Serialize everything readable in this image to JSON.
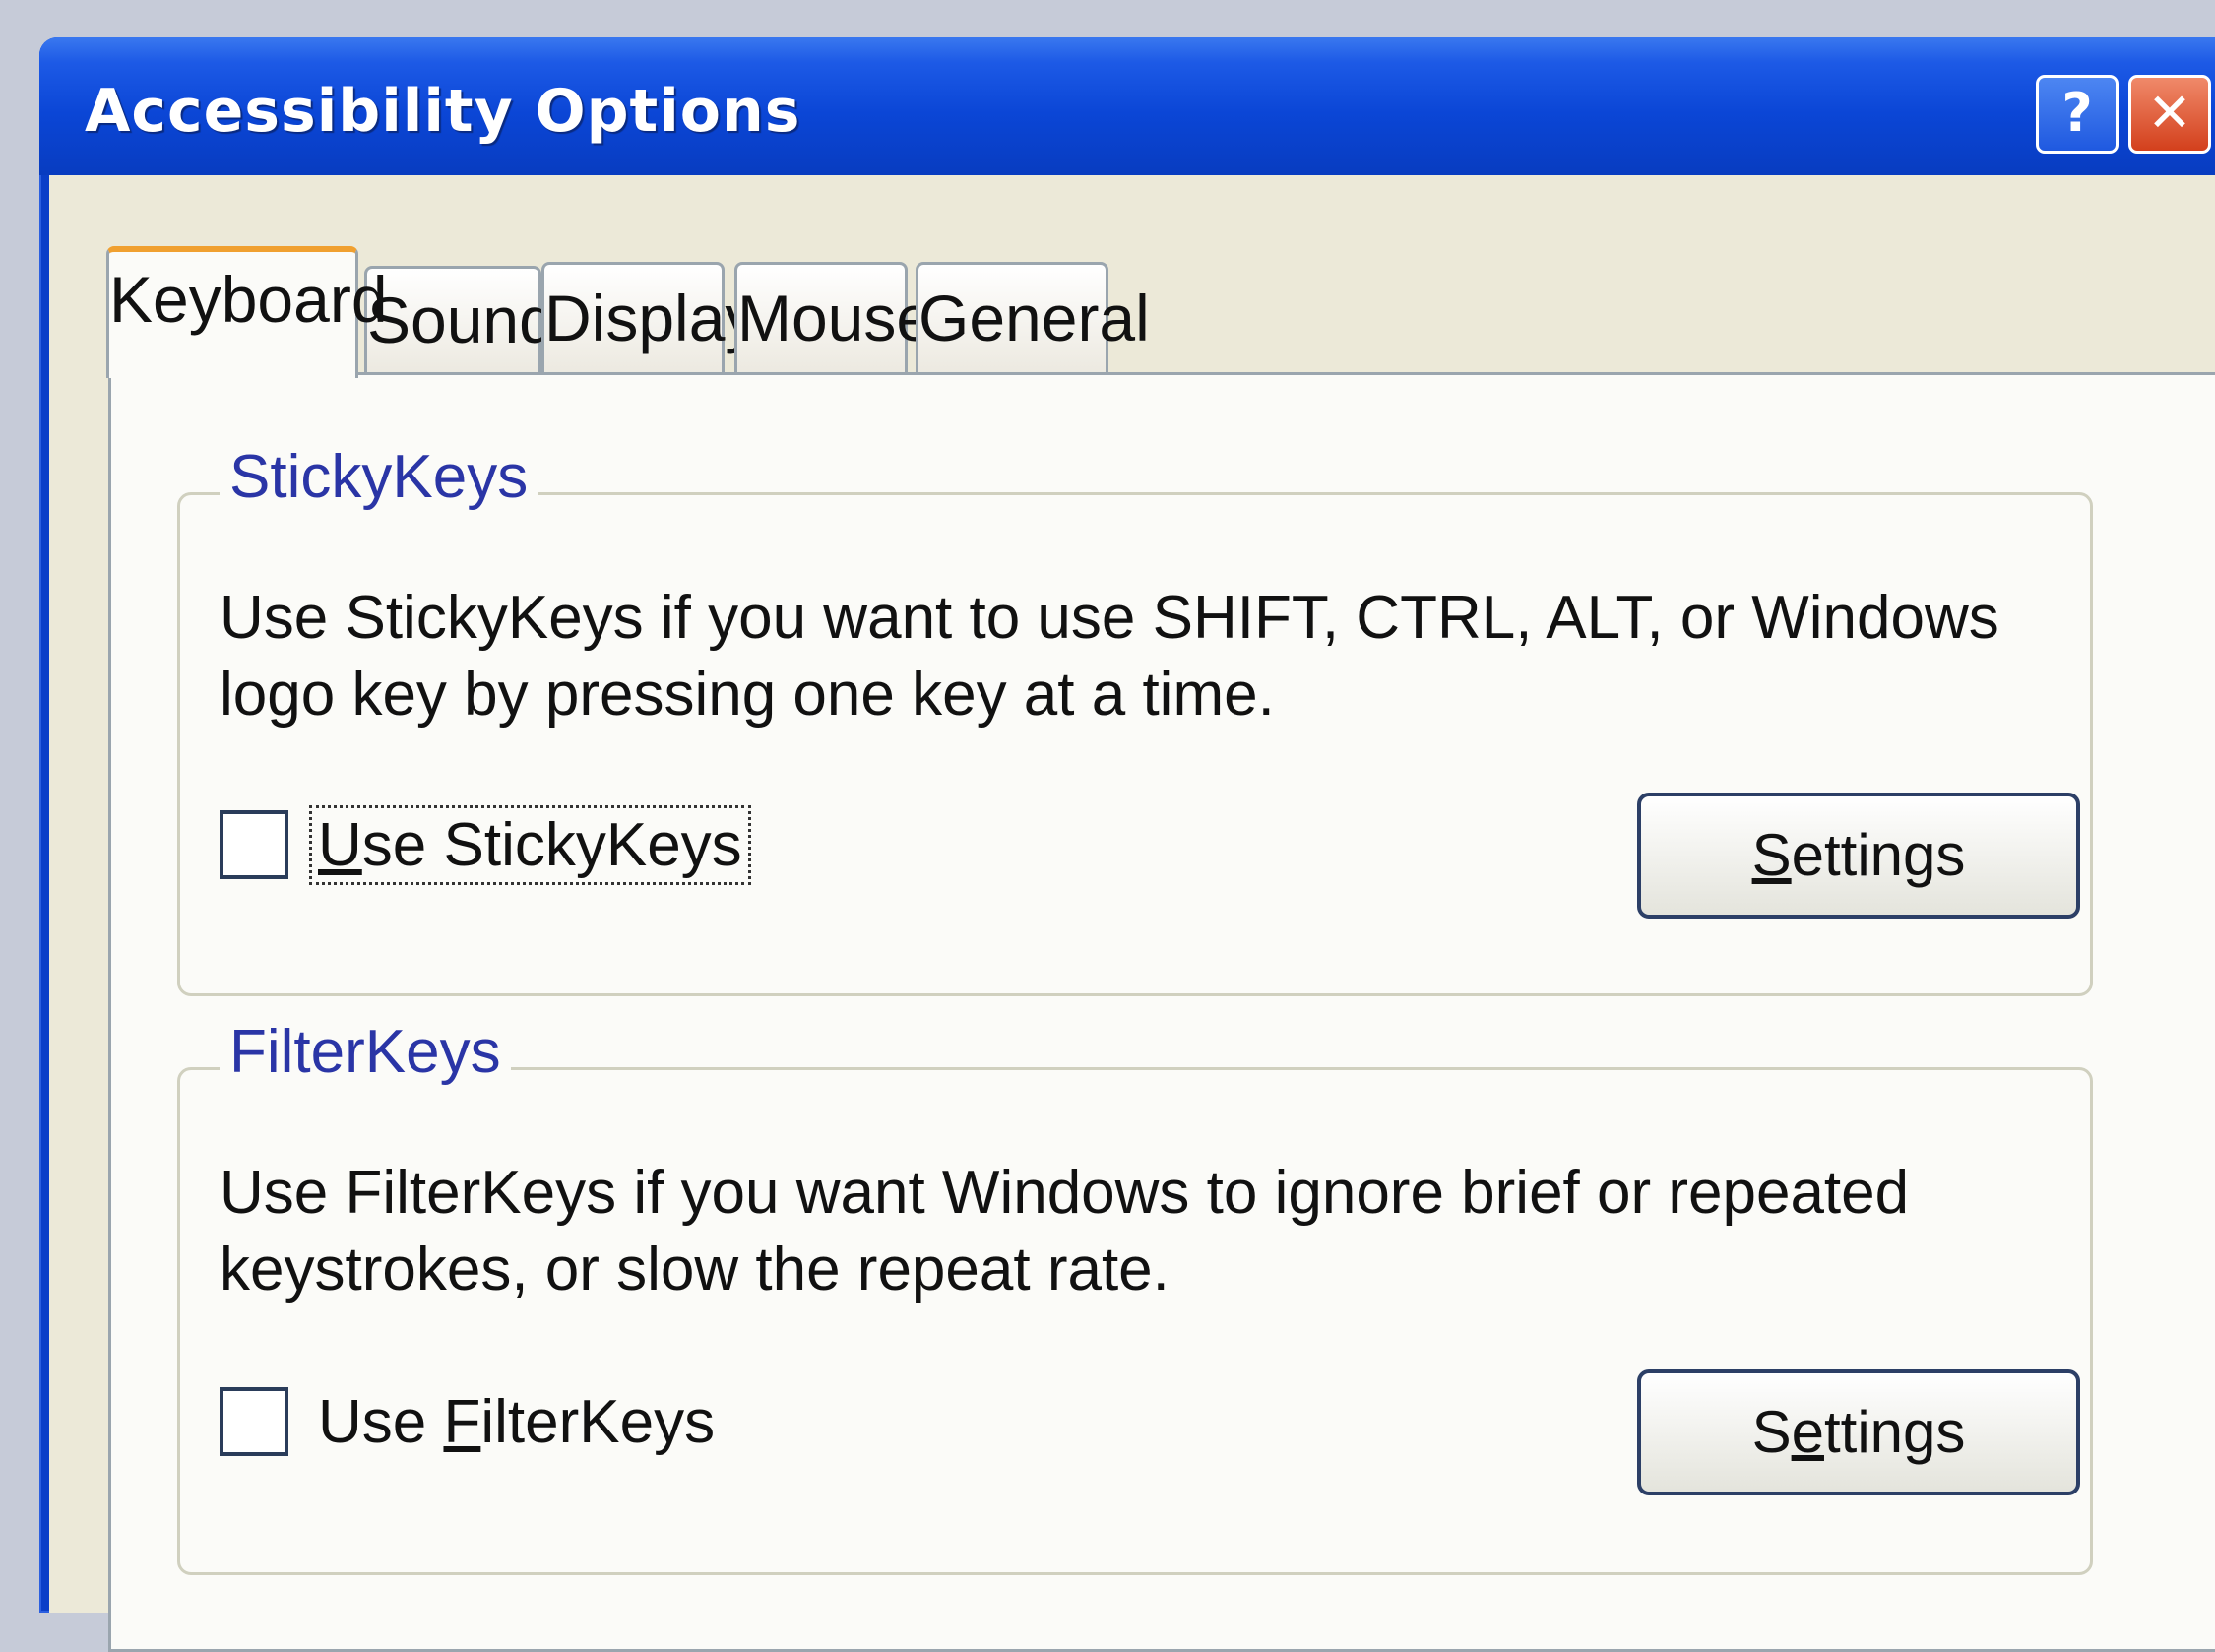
{
  "window": {
    "title": "Accessibility Options",
    "help_glyph": "?",
    "close_glyph": "✕"
  },
  "tabs": [
    {
      "label": "Keyboard",
      "active": true
    },
    {
      "label": "Sound",
      "active": false
    },
    {
      "label": "Display",
      "active": false
    },
    {
      "label": "Mouse",
      "active": false
    },
    {
      "label": "General",
      "active": false
    }
  ],
  "sticky": {
    "title": "StickyKeys",
    "description": "Use StickyKeys if you want to use SHIFT, CTRL, ALT, or Windows logo key by pressing one key at a time.",
    "checkbox": {
      "mnemonic": "U",
      "rest": "se StickyKeys",
      "checked": false
    },
    "settings": {
      "mnemonic": "S",
      "rest": "ettings"
    }
  },
  "filter": {
    "title": "FilterKeys",
    "description": "Use FilterKeys if you want Windows to ignore brief or repeated keystrokes, or slow the repeat rate.",
    "checkbox": {
      "before": "Use ",
      "mnemonic": "F",
      "rest": "ilterKeys",
      "checked": false
    },
    "settings": {
      "before": "S",
      "mnemonic": "e",
      "rest": "ttings"
    }
  }
}
